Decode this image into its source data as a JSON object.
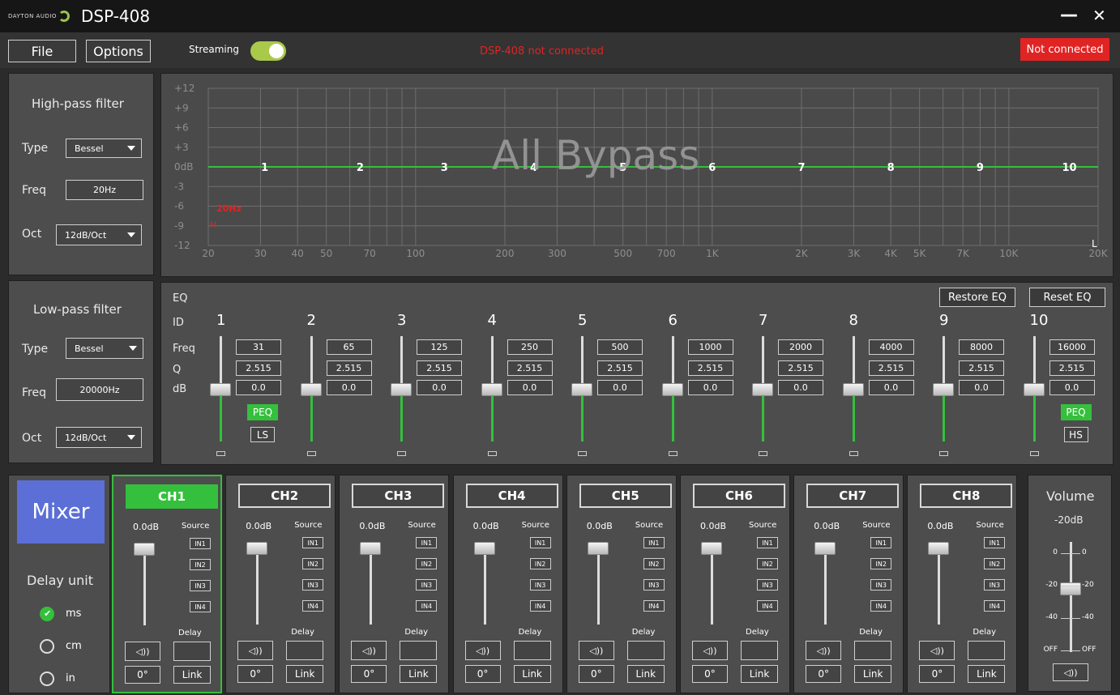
{
  "app": {
    "logo_text": "DAYTON AUDIO",
    "title": "DSP-408",
    "minimize": "—",
    "close": "✕"
  },
  "menu": {
    "file": "File",
    "options": "Options",
    "streaming_label": "Streaming",
    "streaming_on": true,
    "status_message": "DSP-408 not connected",
    "connection_badge": "Not connected"
  },
  "colors": {
    "accent_green": "#3fbf4a",
    "error_red": "#e02424",
    "mixer_blue": "#5b6fd6"
  },
  "highpass": {
    "title": "High-pass filter",
    "type_label": "Type",
    "type_value": "Bessel",
    "freq_label": "Freq",
    "freq_value": "20Hz",
    "oct_label": "Oct",
    "oct_value": "12dB/Oct"
  },
  "lowpass": {
    "title": "Low-pass filter",
    "type_label": "Type",
    "type_value": "Bessel",
    "freq_label": "Freq",
    "freq_value": "20000Hz",
    "oct_label": "Oct",
    "oct_value": "12dB/Oct"
  },
  "graph": {
    "overlay_text": "All Bypass",
    "hp_marker": "20Hz",
    "hp_marker_small": "H",
    "y_ticks": [
      "+12",
      "+9",
      "+6",
      "+3",
      "0dB",
      "-3",
      "-6",
      "-9",
      "-12"
    ],
    "x_ticks": [
      "20",
      "30",
      "40",
      "50",
      "70",
      "100",
      "200",
      "300",
      "500",
      "700",
      "1K",
      "2K",
      "3K",
      "4K",
      "5K",
      "7K",
      "10K",
      "20K"
    ],
    "band_points": [
      "1",
      "2",
      "3",
      "4",
      "5",
      "6",
      "7",
      "8",
      "9",
      "10"
    ],
    "corner_marker": "L"
  },
  "eq": {
    "title": "EQ",
    "row_id": "ID",
    "row_freq": "Freq",
    "row_q": "Q",
    "row_db": "dB",
    "restore": "Restore EQ",
    "reset": "Reset EQ",
    "bands": [
      {
        "id": "1",
        "freq": "31",
        "q": "2.515",
        "db": "0.0",
        "type": "PEQ",
        "shelf": "LS"
      },
      {
        "id": "2",
        "freq": "65",
        "q": "2.515",
        "db": "0.0"
      },
      {
        "id": "3",
        "freq": "125",
        "q": "2.515",
        "db": "0.0"
      },
      {
        "id": "4",
        "freq": "250",
        "q": "2.515",
        "db": "0.0"
      },
      {
        "id": "5",
        "freq": "500",
        "q": "2.515",
        "db": "0.0"
      },
      {
        "id": "6",
        "freq": "1000",
        "q": "2.515",
        "db": "0.0"
      },
      {
        "id": "7",
        "freq": "2000",
        "q": "2.515",
        "db": "0.0"
      },
      {
        "id": "8",
        "freq": "4000",
        "q": "2.515",
        "db": "0.0"
      },
      {
        "id": "9",
        "freq": "8000",
        "q": "2.515",
        "db": "0.0"
      },
      {
        "id": "10",
        "freq": "16000",
        "q": "2.515",
        "db": "0.0",
        "type": "PEQ",
        "shelf": "HS"
      }
    ]
  },
  "mixer": {
    "label": "Mixer",
    "delay_unit_title": "Delay unit",
    "units": [
      {
        "label": "ms",
        "selected": true
      },
      {
        "label": "cm",
        "selected": false
      },
      {
        "label": "in",
        "selected": false
      }
    ],
    "channels": [
      {
        "name": "CH1",
        "gain": "0.0dB",
        "active": true
      },
      {
        "name": "CH2",
        "gain": "0.0dB",
        "active": false
      },
      {
        "name": "CH3",
        "gain": "0.0dB",
        "active": false
      },
      {
        "name": "CH4",
        "gain": "0.0dB",
        "active": false
      },
      {
        "name": "CH5",
        "gain": "0.0dB",
        "active": false
      },
      {
        "name": "CH6",
        "gain": "0.0dB",
        "active": false
      },
      {
        "name": "CH7",
        "gain": "0.0dB",
        "active": false
      },
      {
        "name": "CH8",
        "gain": "0.0dB",
        "active": false
      }
    ],
    "source_label": "Source",
    "inputs": [
      "IN1",
      "IN2",
      "IN3",
      "IN4"
    ],
    "delay_label": "Delay",
    "mute_icon": "◁))",
    "phase": "0°",
    "link": "Link"
  },
  "volume": {
    "title": "Volume",
    "value": "-20dB",
    "scale_left": [
      "0",
      "-20",
      "-40",
      "OFF"
    ],
    "scale_right": [
      "0",
      "-20",
      "-40",
      "OFF"
    ],
    "mute_icon": "◁))"
  }
}
